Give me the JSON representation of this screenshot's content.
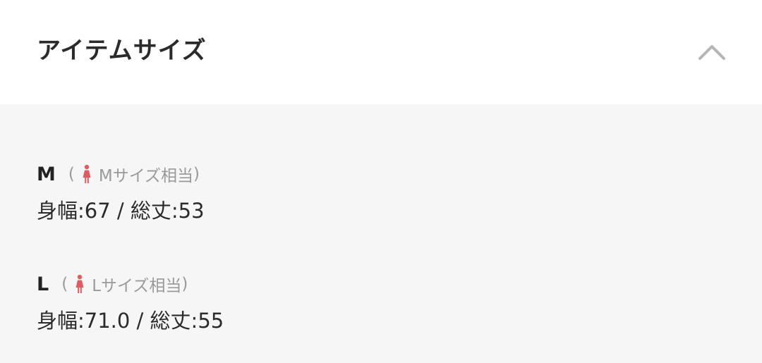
{
  "header": {
    "title": "アイテムサイズ",
    "toggle_icon": "chevron-up-icon"
  },
  "sizes": [
    {
      "label": "M",
      "note_open": "(",
      "note_icon": "female-person-icon",
      "note_text": "Mサイズ相当",
      "note_close": ")",
      "measurements": "身幅:67 / 総丈:53"
    },
    {
      "label": "L",
      "note_open": "(",
      "note_icon": "female-person-icon",
      "note_text": "Lサイズ相当",
      "note_close": ")",
      "measurements": "身幅:71.0 / 総丈:55"
    }
  ],
  "colors": {
    "icon_accent": "#e35a5f",
    "panel_background": "#f6f6f6",
    "note_text": "#9a9a9a",
    "chevron": "#b5b5b5"
  }
}
